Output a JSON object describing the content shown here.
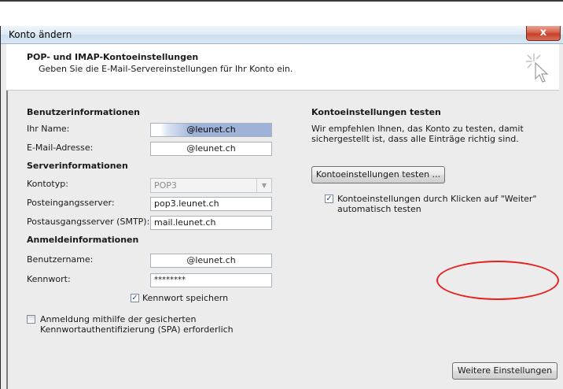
{
  "window": {
    "title": "Konto ändern",
    "close_symbol": "x"
  },
  "header": {
    "title": "POP- und IMAP-Kontoeinstellungen",
    "subtitle": "Geben Sie die E-Mail-Servereinstellungen für Ihr Konto ein."
  },
  "left": {
    "user_info_heading": "Benutzerinformationen",
    "name_label": "Ihr Name:",
    "name_value": "@leunet.ch",
    "email_label": "E-Mail-Adresse:",
    "email_value": "@leunet.ch",
    "server_info_heading": "Serverinformationen",
    "account_type_label": "Kontotyp:",
    "account_type_value": "POP3",
    "incoming_label": "Posteingangsserver:",
    "incoming_value": "pop3.leunet.ch",
    "outgoing_label": "Postausgangsserver (SMTP):",
    "outgoing_value": "mail.leunet.ch",
    "login_info_heading": "Anmeldeinformationen",
    "username_label": "Benutzername:",
    "username_value": "@leunet.ch",
    "password_label": "Kennwort:",
    "password_value": "********",
    "save_password_label": "Kennwort speichern",
    "save_password_checked": true,
    "spa_label_line1": "Anmeldung mithilfe der gesicherten",
    "spa_label_line2": "Kennwortauthentifizierung (SPA) erforderlich",
    "spa_checked": false
  },
  "right": {
    "test_heading": "Kontoeinstellungen testen",
    "test_desc_line1": "Wir empfehlen Ihnen, das Konto zu testen, damit",
    "test_desc_line2": "sichergestellt ist, dass alle Einträge richtig sind.",
    "test_button": "Kontoeinstellungen testen ...",
    "auto_test_line1": "Kontoeinstellungen durch Klicken auf \"Weiter\"",
    "auto_test_line2": "automatisch testen",
    "auto_test_checked": true,
    "more_settings_button": "Weitere Einstellungen"
  },
  "colors": {
    "highlight_ellipse": "#e8201c",
    "checkmark": "#1c4aa3"
  }
}
